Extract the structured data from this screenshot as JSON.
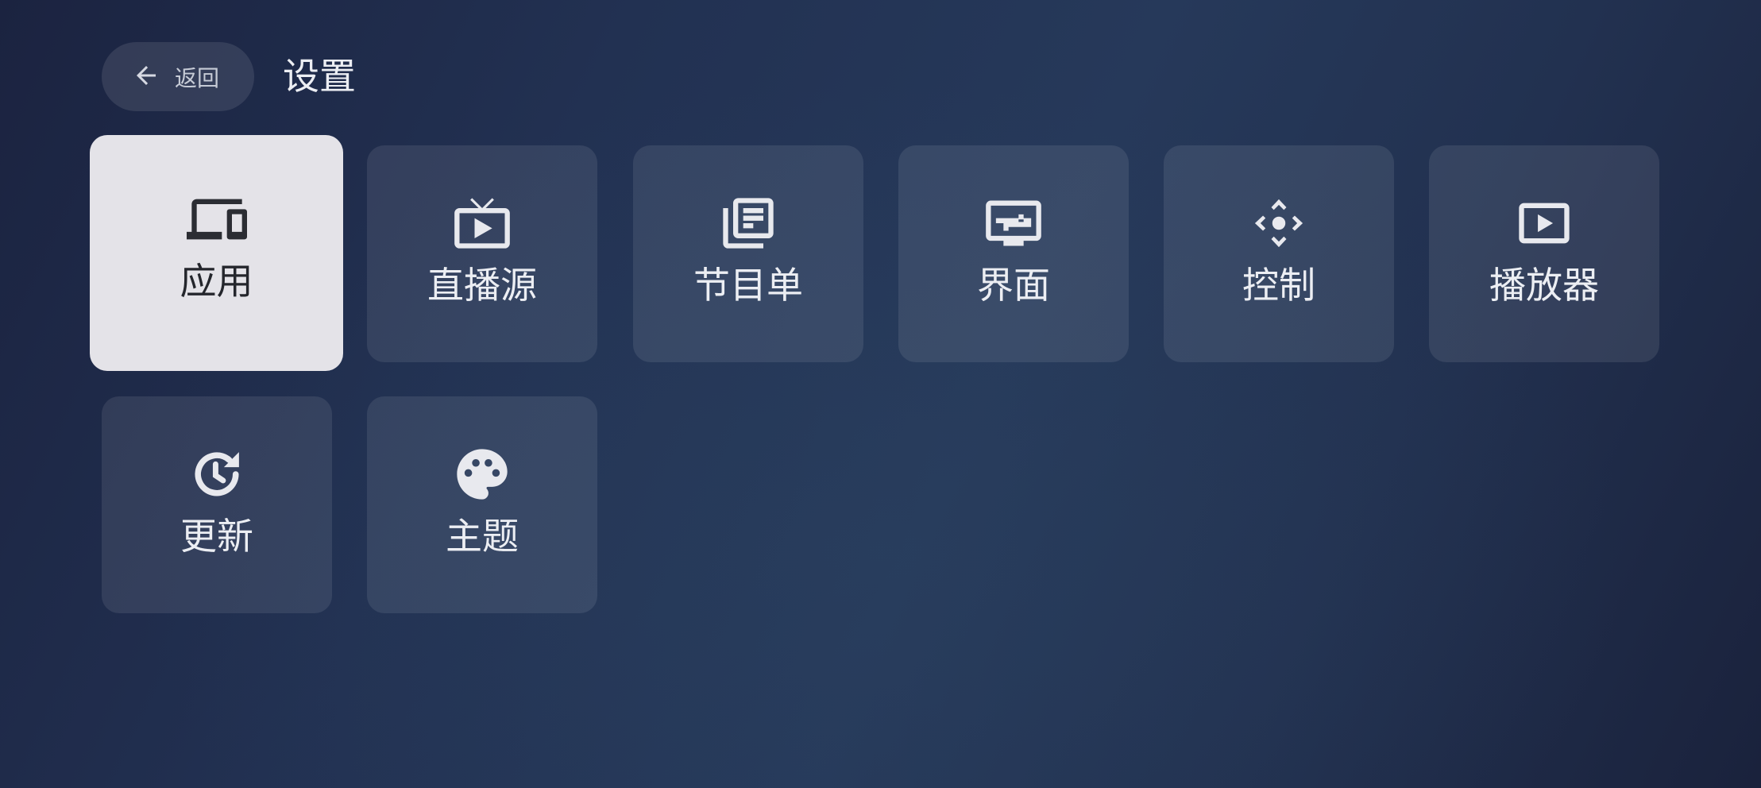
{
  "header": {
    "back_label": "返回",
    "title": "设置"
  },
  "tiles": [
    {
      "label": "应用",
      "icon": "devices-icon",
      "selected": true
    },
    {
      "label": "直播源",
      "icon": "live-tv-icon"
    },
    {
      "label": "节目单",
      "icon": "library-books-icon"
    },
    {
      "label": "界面",
      "icon": "settings-display-icon"
    },
    {
      "label": "控制",
      "icon": "control-dpad-icon"
    },
    {
      "label": "播放器",
      "icon": "play-box-icon"
    },
    {
      "label": "更新",
      "icon": "update-clock-icon"
    },
    {
      "label": "主题",
      "icon": "palette-icon"
    }
  ],
  "colors": {
    "selected_tile_bg": "#e4e3e8",
    "selected_tile_fg": "#24262c",
    "tile_fg": "#eceef3"
  }
}
